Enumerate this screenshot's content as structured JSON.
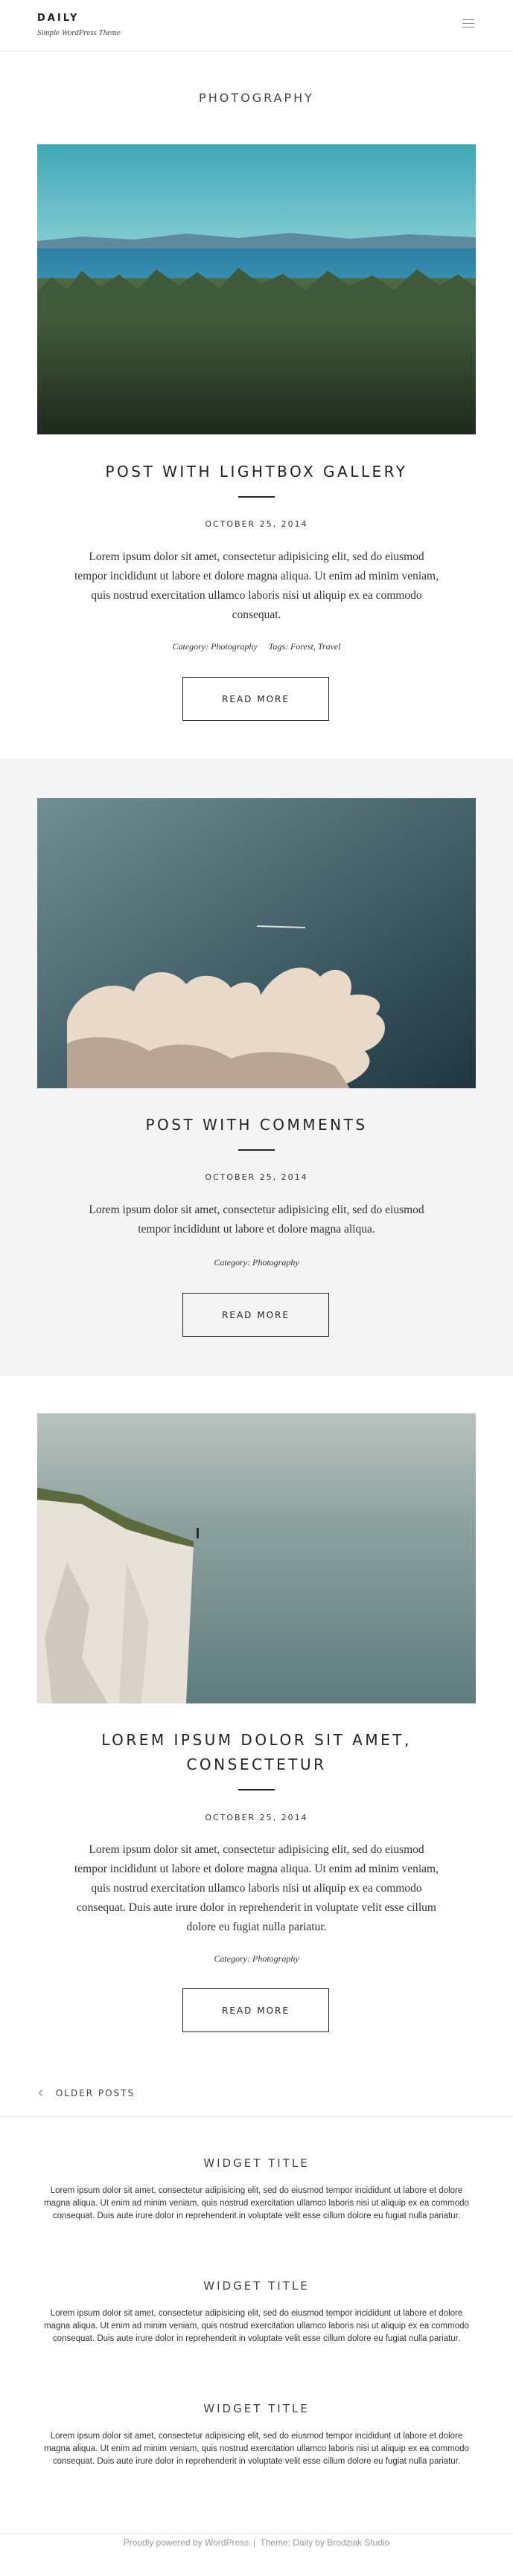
{
  "header": {
    "site_title": "DAILY",
    "site_description": "Simple WordPress Theme",
    "menu_icon": "hamburger-menu-icon"
  },
  "archive": {
    "title": "PHOTOGRAPHY"
  },
  "posts": [
    {
      "title": "POST WITH LIGHTBOX GALLERY",
      "date": "OCTOBER 25, 2014",
      "excerpt": "Lorem ipsum dolor sit amet, consectetur adipisicing elit, sed do eiusmod tempor incididunt ut labore et dolore magna aliqua. Ut enim ad minim veniam, quis nostrud exercitation ullamco laboris nisi ut aliquip ex ea commodo consequat.",
      "category": "Category: Photography",
      "tags": "Tags: Forest, Travel",
      "read_more": "READ MORE"
    },
    {
      "title": "POST WITH COMMENTS",
      "date": "OCTOBER 25, 2014",
      "excerpt": "Lorem ipsum dolor sit amet, consectetur adipisicing elit, sed do eiusmod tempor incididunt ut labore et dolore magna aliqua.",
      "category": "Category: Photography",
      "read_more": "READ MORE"
    },
    {
      "title": "LOREM IPSUM DOLOR SIT AMET, CONSECTETUR",
      "date": "OCTOBER 25, 2014",
      "excerpt": "Lorem ipsum dolor sit amet, consectetur adipisicing elit, sed do eiusmod tempor incididunt ut labore et dolore magna aliqua. Ut enim ad minim veniam, quis nostrud exercitation ullamco laboris nisi ut aliquip ex ea commodo consequat. Duis aute irure dolor in reprehenderit in voluptate velit esse cillum dolore eu fugiat nulla pariatur.",
      "category": "Category: Photography",
      "read_more": "READ MORE"
    }
  ],
  "pagination": {
    "older_label": "OLDER POSTS",
    "icon": "chevron-left-icon"
  },
  "widgets": [
    {
      "title": "WIDGET TITLE",
      "text": "Lorem ipsum dolor sit amet, consectetur adipisicing elit, sed do eiusmod tempor incididunt ut labore et dolore magna aliqua. Ut enim ad minim veniam, quis nostrud exercitation ullamco laboris nisi ut aliquip ex ea commodo consequat. Duis aute irure dolor in reprehenderit in voluptate velit esse cillum dolore eu fugiat nulla pariatur."
    },
    {
      "title": "WIDGET TITLE",
      "text": "Lorem ipsum dolor sit amet, consectetur adipisicing elit, sed do eiusmod tempor incididunt ut labore et dolore magna aliqua. Ut enim ad minim veniam, quis nostrud exercitation ullamco laboris nisi ut aliquip ex ea commodo consequat. Duis aute irure dolor in reprehenderit in voluptate velit esse cillum dolore eu fugiat nulla pariatur."
    },
    {
      "title": "WIDGET TITLE",
      "text": "Lorem ipsum dolor sit amet, consectetur adipisicing elit, sed do eiusmod tempor incididunt ut labore et dolore magna aliqua. Ut enim ad minim veniam, quis nostrud exercitation ullamco laboris nisi ut aliquip ex ea commodo consequat. Duis aute irure dolor in reprehenderit in voluptate velit esse cillum dolore eu fugiat nulla pariatur."
    }
  ],
  "footer": {
    "powered": "Proudly powered by WordPress",
    "separator": "|",
    "theme": "Theme: Daily by Brodziak Studio"
  },
  "colors": {
    "background": "#ffffff",
    "alt_section": "#f4f4f4",
    "text": "#333333",
    "rule": "#222222",
    "footer_text": "#999999"
  }
}
